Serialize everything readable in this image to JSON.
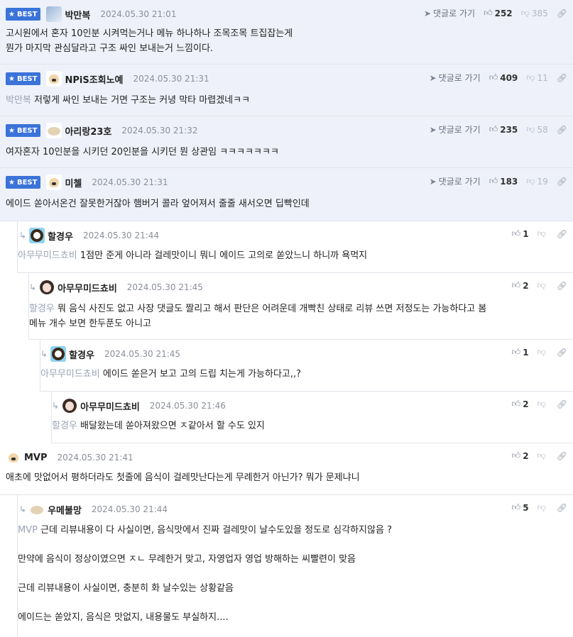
{
  "ui": {
    "best_label": "BEST",
    "reply_label": "댓글로 가기"
  },
  "comments": [
    {
      "nick": "박만복",
      "date": "2024.05.30 21:01",
      "up": "252",
      "down": "385",
      "mention": "",
      "text": "고시원에서 혼자 10인분 시켜먹는거나 메뉴 하나하나 조목조목 트집잡는게\n뭔가 마지막 관심달라고 구조 싸인 보내는거 느낌이다."
    },
    {
      "nick": "NPiS조회노예",
      "date": "2024.05.30 21:31",
      "up": "409",
      "down": "11",
      "mention": "박만복",
      "text": "저렇게 싸인 보내는 거면 구조는 커녕 막타 마렵겠네ㅋㅋ"
    },
    {
      "nick": "아리랑23호",
      "date": "2024.05.30 21:32",
      "up": "235",
      "down": "58",
      "mention": "",
      "text": "여자혼자 10인분을 시키던 20인분을 시키던 뭔 상관임 ㅋㅋㅋㅋㅋㅋㅋ"
    },
    {
      "nick": "미첼",
      "date": "2024.05.30 21:31",
      "up": "183",
      "down": "19",
      "mention": "",
      "text": "에이드 쏟아서온건 잘못한거잖아 햄버거 콜라 엎어져서 줄줄 새서오면 딥빡인데"
    },
    {
      "nick": "할경우",
      "date": "2024.05.30 21:44",
      "up": "1",
      "mention": "아무무미드쵸비",
      "text": "1점만 준게 아니라 걸레맛이니 뭐니 에이드 고의로 쏟았느니 하니까 욕먹지"
    },
    {
      "nick": "아무무미드쵸비",
      "date": "2024.05.30 21:45",
      "up": "2",
      "mention": "할경우",
      "text": "뭐 음식 사진도 없고 사장 댓글도 짤리고 해서 판단은 어려운데 개빡친 상태로 리뷰 쓰면 저정도는 가능하다고 봄\n메뉴 개수 보면 한두푼도 아니고"
    },
    {
      "nick": "할경우",
      "date": "2024.05.30 21:45",
      "up": "1",
      "mention": "아무무미드쵸비",
      "text": "에이드 쏟은거 보고 고의 드립 치는게 가능하다고,,?"
    },
    {
      "nick": "아무무미드쵸비",
      "date": "2024.05.30 21:46",
      "up": "2",
      "mention": "할경우",
      "text": "배달왔는데 쏟아져왔으면 ㅈ같아서 할 수도 있지"
    },
    {
      "nick": "MVP",
      "date": "2024.05.30 21:41",
      "up": "2",
      "mention": "",
      "text": "애초에 맛없어서 평하더라도 첫줄에 음식이 걸레맛난다는게 무례한거 아닌가? 뭐가 문제냐니"
    },
    {
      "nick": "우메불망",
      "date": "2024.05.30 21:44",
      "up": "5",
      "mention": "MVP",
      "text": "근데 리뷰내용이 다 사실이면, 음식맛에서 진짜 걸레맛이 날수도있을 정도로 심각하지않음 ?\n\n만약에 음식이 정상이였으면 ㅈㄴ 무례한거 맞고, 자영업자 영업 방해하는 씨빨련이 맞음\n\n근데 리뷰내용이 사실이면, 충분히 화 날수있는 상황같음\n\n에이드는 쏟았지, 음식은 맛없지, 내용물도 부실하지...."
    }
  ]
}
